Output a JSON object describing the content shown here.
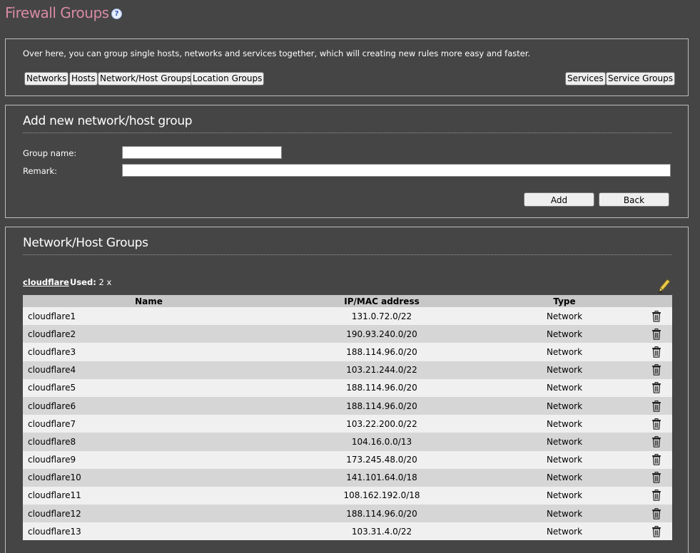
{
  "page": {
    "title": "Firewall Groups",
    "help_icon": "help-icon"
  },
  "intro": {
    "text": "Over here, you can group single hosts, networks and services together, which will creating new rules more easy and faster.",
    "buttons": [
      "Networks",
      "Hosts",
      "Network/Host Groups",
      "Location Groups",
      "Services",
      "Service Groups"
    ]
  },
  "add_form": {
    "heading": "Add new network/host group",
    "group_name_label": "Group name:",
    "group_name_value": "",
    "remark_label": "Remark:",
    "remark_value": "",
    "add_button": "Add",
    "back_button": "Back"
  },
  "groups_section": {
    "heading": "Network/Host Groups",
    "group": {
      "name": "cloudflare",
      "used_label": "Used:",
      "used_value": "2 x",
      "edit_icon": "pencil-icon"
    },
    "columns": [
      "Name",
      "IP/MAC address",
      "Type"
    ],
    "rows": [
      {
        "name": "cloudflare1",
        "ip": "131.0.72.0/22",
        "type": "Network"
      },
      {
        "name": "cloudflare2",
        "ip": "190.93.240.0/20",
        "type": "Network"
      },
      {
        "name": "cloudflare3",
        "ip": "188.114.96.0/20",
        "type": "Network"
      },
      {
        "name": "cloudflare4",
        "ip": "103.21.244.0/22",
        "type": "Network"
      },
      {
        "name": "cloudflare5",
        "ip": "188.114.96.0/20",
        "type": "Network"
      },
      {
        "name": "cloudflare6",
        "ip": "188.114.96.0/20",
        "type": "Network"
      },
      {
        "name": "cloudflare7",
        "ip": "103.22.200.0/22",
        "type": "Network"
      },
      {
        "name": "cloudflare8",
        "ip": "104.16.0.0/13",
        "type": "Network"
      },
      {
        "name": "cloudflare9",
        "ip": "173.245.48.0/20",
        "type": "Network"
      },
      {
        "name": "cloudflare10",
        "ip": "141.101.64.0/18",
        "type": "Network"
      },
      {
        "name": "cloudflare11",
        "ip": "108.162.192.0/18",
        "type": "Network"
      },
      {
        "name": "cloudflare12",
        "ip": "188.114.96.0/20",
        "type": "Network"
      },
      {
        "name": "cloudflare13",
        "ip": "103.31.4.0/22",
        "type": "Network"
      }
    ],
    "delete_icon": "trash-icon"
  },
  "colors": {
    "background": "#454545",
    "title": "#d98aa6",
    "row_odd": "#f0f0f0",
    "row_even": "#d6d6d6",
    "header": "#c8c8c8"
  }
}
